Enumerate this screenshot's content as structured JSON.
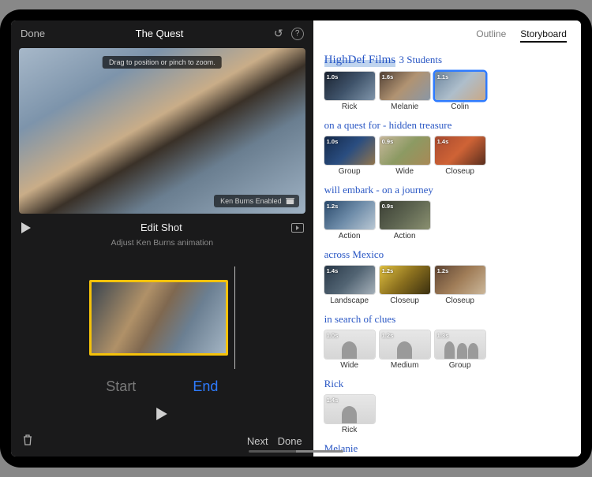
{
  "left": {
    "done": "Done",
    "title": "The Quest",
    "tip": "Drag to position or pinch to zoom.",
    "ken_burns_badge": "Ken Burns Enabled",
    "editshot": "Edit Shot",
    "subtitle": "Adjust Ken Burns animation",
    "start_label": "Start",
    "end_label": "End",
    "next": "Next",
    "done2": "Done"
  },
  "right": {
    "tabs": {
      "outline": "Outline",
      "storyboard": "Storyboard"
    },
    "film_title": "HighDef Films",
    "sections": [
      {
        "title": "3 Students",
        "clips": [
          {
            "label": "Rick",
            "dur": "1.0s",
            "cls": "g1"
          },
          {
            "label": "Melanie",
            "dur": "1.6s",
            "cls": "g2"
          },
          {
            "label": "Colin",
            "dur": "1.1s",
            "cls": "g3",
            "selected": true
          }
        ]
      },
      {
        "title": "on a quest for - hidden treasure",
        "clips": [
          {
            "label": "Group",
            "dur": "1.0s",
            "cls": "g4"
          },
          {
            "label": "Wide",
            "dur": "0.9s",
            "cls": "g5"
          },
          {
            "label": "Closeup",
            "dur": "1.4s",
            "cls": "g6"
          }
        ]
      },
      {
        "title": "will embark - on a journey",
        "clips": [
          {
            "label": "Action",
            "dur": "1.2s",
            "cls": "g7"
          },
          {
            "label": "Action",
            "dur": "0.9s",
            "cls": "g8"
          }
        ]
      },
      {
        "title": "across Mexico",
        "clips": [
          {
            "label": "Landscape",
            "dur": "1.4s",
            "cls": "g9"
          },
          {
            "label": "Closeup",
            "dur": "1.2s",
            "cls": "g10"
          },
          {
            "label": "Closeup",
            "dur": "1.2s",
            "cls": "g11"
          }
        ]
      },
      {
        "title": "in search of clues",
        "clips": [
          {
            "label": "Wide",
            "dur": "1.0s",
            "cls": "placeholder",
            "multi": false
          },
          {
            "label": "Medium",
            "dur": "1.2s",
            "cls": "placeholder",
            "multi": false
          },
          {
            "label": "Group",
            "dur": "1.3s",
            "cls": "placeholder",
            "multi": true
          }
        ]
      },
      {
        "title": "Rick",
        "clips": [
          {
            "label": "Rick",
            "dur": "1.4s",
            "cls": "placeholder",
            "multi": false
          }
        ]
      },
      {
        "title": "Melanie",
        "clips": []
      }
    ]
  }
}
